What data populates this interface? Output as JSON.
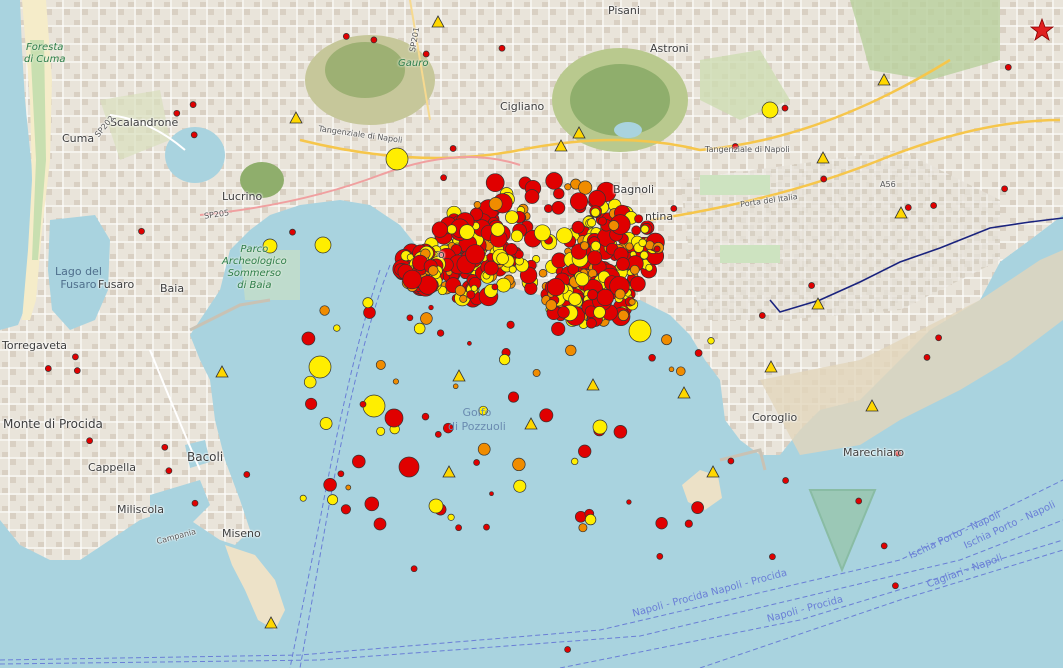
{
  "map": {
    "places": [
      {
        "id": "pisani",
        "text": "Pisani"
      },
      {
        "id": "astroni",
        "text": "Astroni"
      },
      {
        "id": "cigliano",
        "text": "Cigliano"
      },
      {
        "id": "cuma",
        "text": "Cuma"
      },
      {
        "id": "scalandrone",
        "text": "Scalandrone"
      },
      {
        "id": "lucrino",
        "text": "Lucrino"
      },
      {
        "id": "fusaro",
        "text": "Fusaro"
      },
      {
        "id": "baia",
        "text": "Baia"
      },
      {
        "id": "torregaveta",
        "text": "Torregaveta"
      },
      {
        "id": "monte_di_procida",
        "text": "Monte di Procida"
      },
      {
        "id": "cappella",
        "text": "Cappella"
      },
      {
        "id": "bacoli",
        "text": "Bacoli"
      },
      {
        "id": "miliscola",
        "text": "Miliscola"
      },
      {
        "id": "miseno",
        "text": "Miseno"
      },
      {
        "id": "coroglio",
        "text": "Coroglio"
      },
      {
        "id": "marechiaro",
        "text": "Marechiaro"
      },
      {
        "id": "pozzuoli_partial",
        "text": "o"
      },
      {
        "id": "agnano_partial",
        "text": "Bagnoli"
      },
      {
        "id": "fuorigrotta_partial",
        "text": "ntina"
      }
    ],
    "green_labels": [
      {
        "id": "foresta",
        "lines": [
          "Foresta",
          "di Cuma"
        ]
      },
      {
        "id": "parco",
        "lines": [
          "Parco",
          "Archeologico",
          "Sommerso",
          "di Baia"
        ]
      },
      {
        "id": "gauro",
        "lines": [
          "Gauro"
        ]
      }
    ],
    "water_labels": [
      {
        "id": "lago_fusaro",
        "lines": [
          "Lago del",
          "Fusaro"
        ]
      },
      {
        "id": "golfo",
        "lines": [
          "Golfo",
          "di Pozzuoli"
        ]
      }
    ],
    "road_labels": [
      {
        "id": "tangenziale1",
        "text": "Tangenziale di Napoli"
      },
      {
        "id": "tangenziale2",
        "text": "Tangenziale di Napoli"
      },
      {
        "id": "sp205",
        "text": "SP205"
      },
      {
        "id": "a56",
        "text": "A56"
      },
      {
        "id": "sp201",
        "text": "SP201"
      },
      {
        "id": "sp202",
        "text": "SP202"
      },
      {
        "id": "campana",
        "text": "Campania"
      },
      {
        "id": "porta",
        "text": "Porta del Italia"
      }
    ],
    "ferry_labels": [
      {
        "id": "f1",
        "text": "Napoli - Procida  Napoli - Procida"
      },
      {
        "id": "f2",
        "text": "Napoli - Procida"
      },
      {
        "id": "f3",
        "text": "Cagliari - Napoli"
      },
      {
        "id": "f4",
        "text": "Ischia Porto - Napoli"
      },
      {
        "id": "f5",
        "text": "Ischia Porto - Napoli"
      }
    ],
    "colors": {
      "sea": "#a9d3df",
      "land": "#f0ebe1",
      "quake_large": "#e00000",
      "quake_mid": "#f08c00",
      "quake_small": "#ffee00",
      "station": "#ffd700",
      "ferry": "#6a7fd6",
      "railway": "#1a237e"
    },
    "legend_star": "red-star-icon"
  }
}
